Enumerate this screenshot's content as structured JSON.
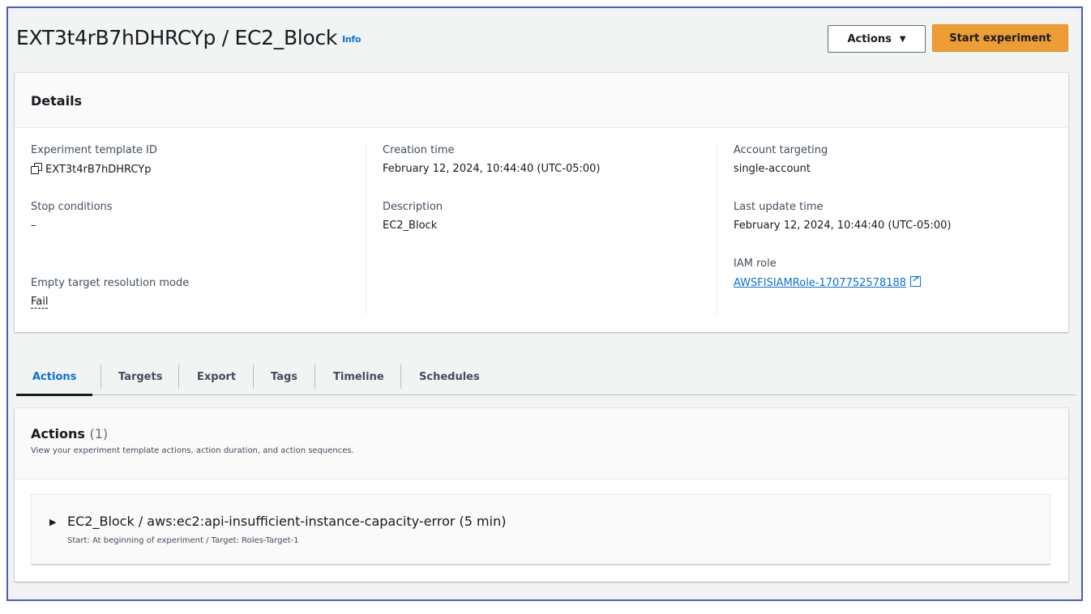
{
  "header": {
    "title": "EXT3t4rB7hDHRCYp / EC2_Block",
    "info": "Info",
    "actions_label": "Actions",
    "start_label": "Start experiment"
  },
  "details": {
    "title": "Details",
    "template_id_label": "Experiment template ID",
    "template_id": "EXT3t4rB7hDHRCYp",
    "stop_conditions_label": "Stop conditions",
    "stop_conditions": "–",
    "empty_target_label": "Empty target resolution mode",
    "empty_target": "Fail",
    "creation_time_label": "Creation time",
    "creation_time": "February 12, 2024, 10:44:40 (UTC-05:00)",
    "description_label": "Description",
    "description": "EC2_Block",
    "account_targeting_label": "Account targeting",
    "account_targeting": "single-account",
    "last_update_label": "Last update time",
    "last_update": "February 12, 2024, 10:44:40 (UTC-05:00)",
    "iam_role_label": "IAM role",
    "iam_role": "AWSFISIAMRole-1707752578188"
  },
  "tabs": [
    {
      "label": "Actions"
    },
    {
      "label": "Targets"
    },
    {
      "label": "Export"
    },
    {
      "label": "Tags"
    },
    {
      "label": "Timeline"
    },
    {
      "label": "Schedules"
    }
  ],
  "actions_section": {
    "title": "Actions",
    "count": "(1)",
    "description": "View your experiment template actions, action duration, and action sequences.",
    "items": [
      {
        "title": "EC2_Block / aws:ec2:api-insufficient-instance-capacity-error (5 min)",
        "subtitle": "Start: At beginning of experiment / Target: Roles-Target-1"
      }
    ]
  },
  "colors": {
    "accent": "#0972d3",
    "primary_button": "#ec9d36",
    "frame_border": "#4a5db8"
  }
}
